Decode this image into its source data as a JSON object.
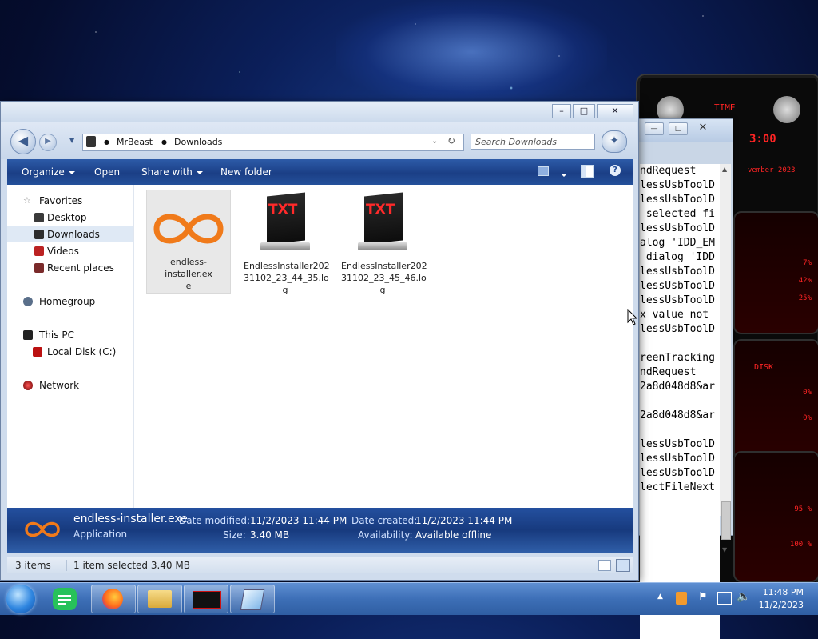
{
  "explorer": {
    "address": {
      "crumb1": "MrBeast",
      "crumb2": "Downloads"
    },
    "search_placeholder": "Search Downloads",
    "commands": {
      "organize": "Organize",
      "open": "Open",
      "share_with": "Share with",
      "new_folder": "New folder"
    },
    "nav": {
      "favorites": "Favorites",
      "desktop": "Desktop",
      "downloads": "Downloads",
      "videos": "Videos",
      "recent_places": "Recent places",
      "homegroup": "Homegroup",
      "this_pc": "This PC",
      "local_disk": "Local Disk (C:)",
      "network": "Network"
    },
    "files": [
      {
        "name": "endless-installer.exe",
        "line1": "endless-installer.ex",
        "line2": "e",
        "line3": ""
      },
      {
        "name": "EndlessInstaller20231102_23_44_35.log",
        "line1": "EndlessInstaller202",
        "line2": "31102_23_44_35.lo",
        "line3": "g"
      },
      {
        "name": "EndlessInstaller20231102_23_45_46.log",
        "line1": "EndlessInstaller202",
        "line2": "31102_23_45_46.lo",
        "line3": "g"
      }
    ],
    "txt_icon_label": "TXT",
    "details": {
      "file_name": "endless-installer.exe",
      "file_type": "Application",
      "modified_label": "Date modified:",
      "modified_value": "11/2/2023 11:44 PM",
      "size_label": "Size:",
      "size_value": "3.40 MB",
      "created_label": "Date created:",
      "created_value": "11/2/2023 11:44 PM",
      "availability_label": "Availability:",
      "availability_value": "Available offline"
    },
    "status": {
      "items": "3 items",
      "selected": "1 item selected 3.40 MB"
    }
  },
  "console": {
    "lines": [
      "ndRequest",
      "lessUsbToolD",
      "lessUsbToolD",
      " selected fi",
      "lessUsbToolD",
      "alog 'IDD_EM",
      " dialog 'IDD",
      "lessUsbToolD",
      "lessUsbToolD",
      "lessUsbToolD",
      "x value not ",
      "lessUsbToolD",
      "",
      "reenTracking",
      "ndRequest",
      "2a8d048d8&ar",
      "",
      "2a8d048d8&ar",
      "",
      "lessUsbToolD",
      "lessUsbToolD",
      "lessUsbToolD",
      "lectFileNext"
    ]
  },
  "gadget": {
    "time_label": "TIME",
    "time_value": "3:00",
    "date_text": "vember 2023",
    "cpu_values": [
      "7%",
      "42%",
      "25%"
    ],
    "disk_label": "DISK",
    "disk_values": [
      "0%",
      "0%"
    ],
    "mem_values": [
      "95 %",
      "100 %"
    ]
  },
  "taskbar": {
    "time": "11:48 PM",
    "date": "11/2/2023"
  },
  "colors": {
    "accent": "#1f4a96",
    "exe_icon": "#f07a1a",
    "txt_red": "#ff2a2a"
  }
}
